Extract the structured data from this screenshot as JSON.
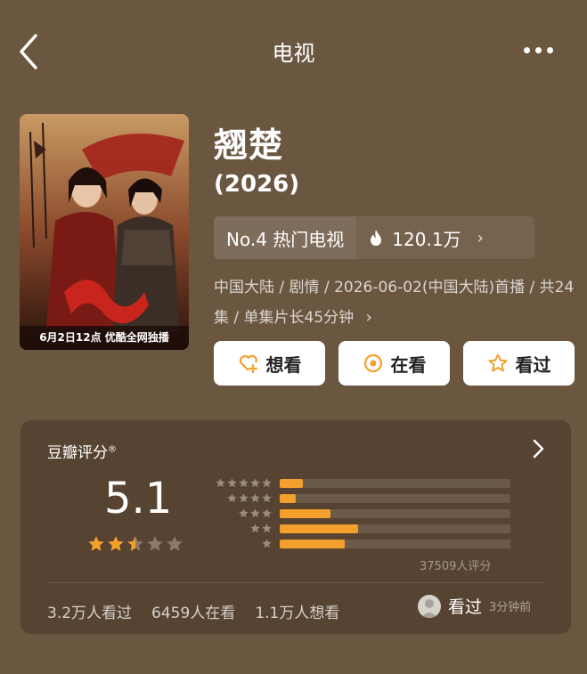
{
  "header": {
    "title": "电视"
  },
  "poster": {
    "caption": "6月2日12点 优酷全网独播"
  },
  "show": {
    "title": "翘楚",
    "year": "(2026)",
    "rank_label": "No.4 热门电视",
    "heat": "120.1万",
    "meta": "中国大陆 / 剧情 / 2026-06-02(中国大陆)首播 / 共24集 / 单集片长45分钟"
  },
  "actions": {
    "want": "想看",
    "watching": "在看",
    "watched": "看过"
  },
  "rating": {
    "label": "豆瓣评分",
    "mark": "®",
    "score": "5.1",
    "stars_value": 2.5,
    "distribution": [
      {
        "stars": 5,
        "fraction": 0.1
      },
      {
        "stars": 4,
        "fraction": 0.07
      },
      {
        "stars": 3,
        "fraction": 0.22
      },
      {
        "stars": 2,
        "fraction": 0.34
      },
      {
        "stars": 1,
        "fraction": 0.28
      }
    ],
    "votes": "37509人评分"
  },
  "stats": {
    "watched": "3.2万人看过",
    "watching": "6459人在看",
    "want": "1.1万人想看"
  },
  "my_status": {
    "label": "看过",
    "time": "3分钟前"
  },
  "colors": {
    "background": "#6b5640",
    "card": "#574331",
    "accent": "#f3a02c",
    "star_empty": "#8a7a6a"
  },
  "icons": [
    "back-chevron-icon",
    "more-dots-icon",
    "flame-icon",
    "heart-plus-icon",
    "target-icon",
    "star-outline-icon",
    "chevron-right-icon",
    "avatar-icon"
  ]
}
